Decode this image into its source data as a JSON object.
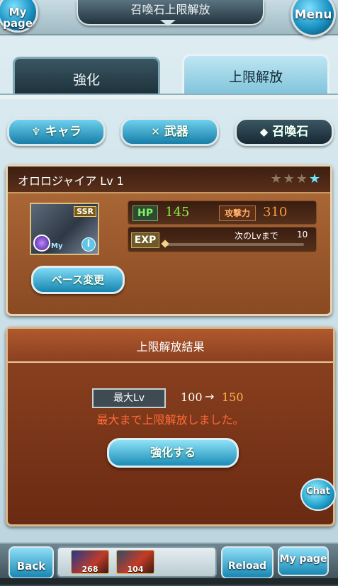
{
  "header": {
    "title": "召喚石上限解放",
    "mypage_label": "My page",
    "menu_label": "Menu"
  },
  "tabs": [
    {
      "label": "強化",
      "active": false
    },
    {
      "label": "上限解放",
      "active": true
    }
  ],
  "categories": [
    {
      "label": "キャラ",
      "icon": "person-icon"
    },
    {
      "label": "武器",
      "icon": "swords-icon"
    },
    {
      "label": "召喚石",
      "icon": "crystal-icon",
      "active": true
    }
  ],
  "summon": {
    "name": "オロロジャイア Lv 1",
    "rarity": "SSR",
    "my_badge": "My",
    "stars_total": 4,
    "stars_filled": 1,
    "hp_label": "HP",
    "hp": "145",
    "atk_label": "攻撃力",
    "atk": "310",
    "exp_label": "EXP",
    "next_label": "次のLvまで",
    "next_value": "10",
    "exp_progress": 0.02,
    "base_change_label": "ベース変更"
  },
  "result": {
    "title": "上限解放結果",
    "max_lv_label": "最大Lv",
    "old_level": "100",
    "arrow": "→",
    "new_level": "150",
    "message": "最大まで上限解放しました。",
    "enhance_label": "強化する",
    "chat_label": "Chat"
  },
  "footer": {
    "back_label": "Back",
    "items": [
      {
        "count": "268"
      },
      {
        "count": "104"
      }
    ],
    "reload_label": "Reload",
    "mypage_label": "My page"
  },
  "colors": {
    "hp": "#8cf14a",
    "atk": "#ff9a3c",
    "new_level": "#ffb44a",
    "message": "#ff6b3a"
  }
}
